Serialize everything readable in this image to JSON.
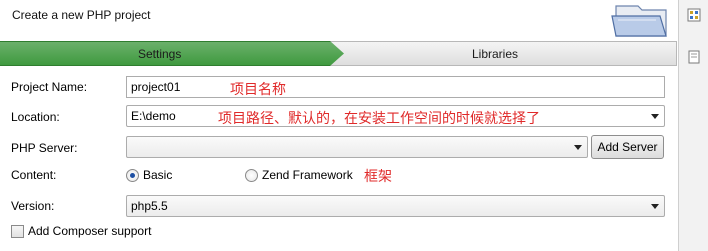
{
  "header": {
    "title": "Create a new PHP project"
  },
  "tabs": [
    {
      "label": "Settings",
      "active": true
    },
    {
      "label": "Libraries",
      "active": false
    }
  ],
  "form": {
    "project_name": {
      "label": "Project Name:",
      "value": "project01",
      "annotation": "项目名称"
    },
    "location": {
      "label": "Location:",
      "value": "E:\\demo",
      "annotation": "项目路径、默认的，在安装工作空间的时候就选择了"
    },
    "php_server": {
      "label": "PHP Server:",
      "value": "",
      "button": "Add Server"
    },
    "content": {
      "label": "Content:",
      "options": [
        {
          "label": "Basic",
          "selected": true
        },
        {
          "label": "Zend Framework",
          "selected": false
        }
      ],
      "annotation": "框架"
    },
    "version": {
      "label": "Version:",
      "value": "php5.5"
    },
    "composer": {
      "label": "Add Composer support",
      "checked": false
    }
  },
  "colors": {
    "active_tab": "#4fa34f",
    "annotation": "#e02a2a",
    "radio_dot": "#1d4fa3"
  },
  "icons": [
    "wizard-folder-icon",
    "side-panel-icon",
    "side-panel-page-icon"
  ]
}
